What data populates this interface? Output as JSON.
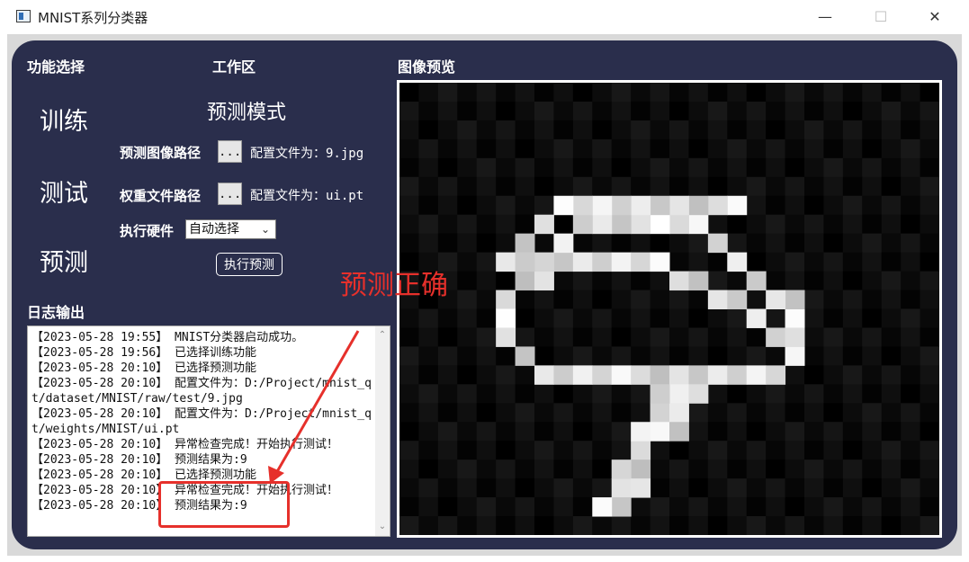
{
  "window": {
    "title": "MNIST系列分类器",
    "minimize": "—",
    "maximize": "☐",
    "close": "✕"
  },
  "sections": {
    "function_select": "功能选择",
    "workspace": "工作区",
    "preview": "图像预览",
    "log": "日志输出"
  },
  "nav": {
    "train": "训练",
    "test": "测试",
    "predict": "预测"
  },
  "workspace": {
    "mode_title": "预测模式",
    "image_path_label": "预测图像路径",
    "image_browse": "...",
    "image_config": "配置文件为：9.jpg",
    "weights_path_label": "权重文件路径",
    "weights_browse": "...",
    "weights_config": "配置文件为：ui.pt",
    "hardware_label": "执行硬件",
    "hardware_value": "自动选择",
    "run_button": "执行预测"
  },
  "log_lines": [
    "【2023-05-28 19:55】 MNIST分类器启动成功。",
    "【2023-05-28 19:56】 已选择训练功能",
    "【2023-05-28 20:10】 已选择预测功能",
    "【2023-05-28 20:10】 配置文件为：D:/Project/mnist_qt/dataset/MNIST/raw/test/9.jpg",
    "【2023-05-28 20:10】 配置文件为：D:/Project/mnist_qt/weights/MNIST/ui.pt",
    "【2023-05-28 20:10】 异常检查完成！开始执行测试！",
    "【2023-05-28 20:10】 预测结果为:9",
    "【2023-05-28 20:10】 已选择预测功能",
    "【2023-05-28 20:10】 异常检查完成！开始执行测试！",
    "【2023-05-28 20:10】 预测结果为:9"
  ],
  "annotation": {
    "text": "预测正确",
    "color": "#e6302b"
  },
  "colors": {
    "panel_bg": "#2a2e4c",
    "accent_red": "#e6302b"
  }
}
